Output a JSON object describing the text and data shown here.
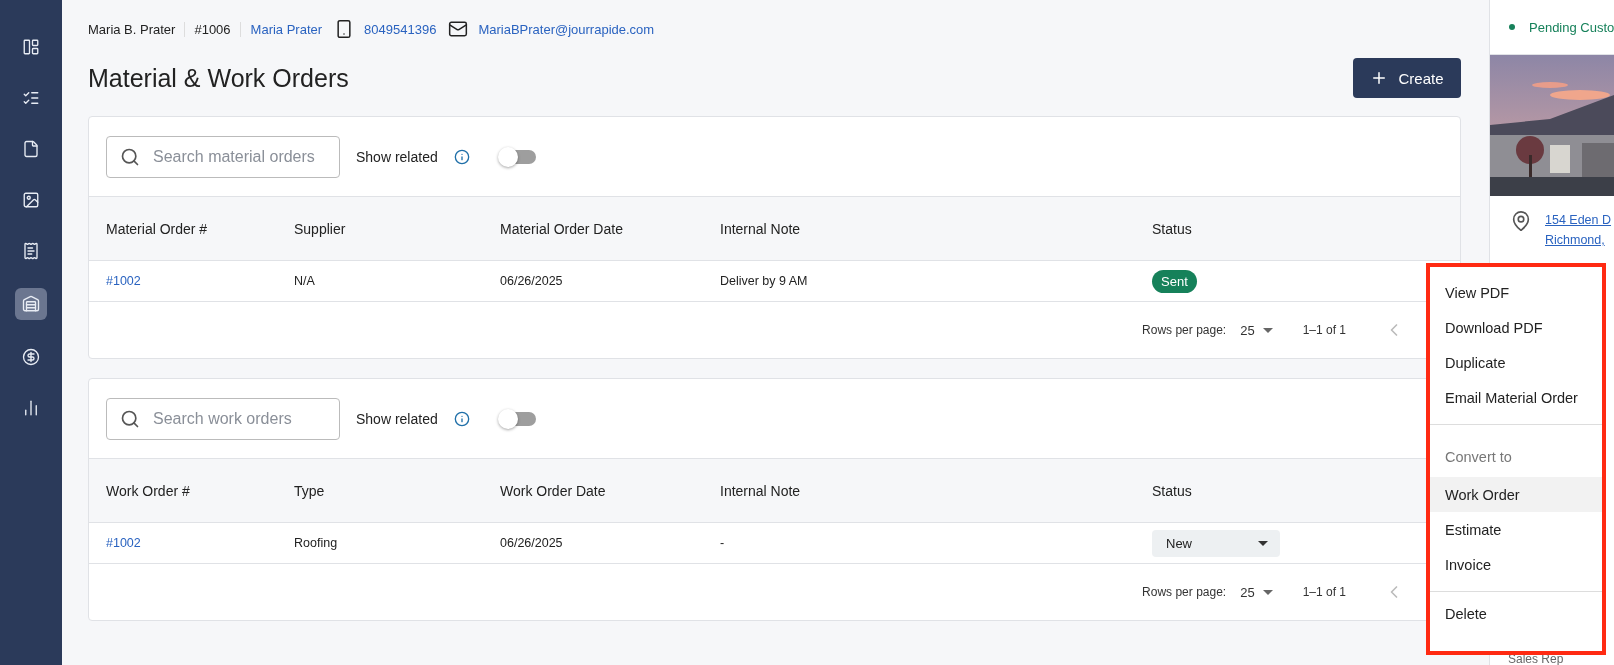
{
  "sidebar": {
    "items": [
      {
        "selected": false
      },
      {
        "selected": false
      },
      {
        "selected": false
      },
      {
        "selected": false
      },
      {
        "selected": false
      },
      {
        "selected": true
      },
      {
        "selected": false
      },
      {
        "selected": false
      }
    ]
  },
  "contact": {
    "name": "Maria B. Prater",
    "number": "#1006",
    "link_name": "Maria Prater",
    "phone": "8049541396",
    "email": "MariaBPrater@jourrapide.com"
  },
  "page_title": "Material & Work Orders",
  "create_button": "Create",
  "tables": [
    {
      "search": {
        "placeholder": "Search material orders"
      },
      "show_related": {
        "label": "Show related",
        "on": false
      },
      "columns": [
        "Material Order #",
        "Supplier",
        "Material Order Date",
        "Internal Note",
        "Status"
      ],
      "rows": [
        {
          "number": "#1002",
          "col2": "N/A",
          "date": "06/26/2025",
          "note": "Deliver by 9 AM",
          "status": {
            "kind": "badge",
            "label": "Sent"
          }
        }
      ],
      "pagination": {
        "label": "Rows per page:",
        "per_page": "25",
        "range": "1–1 of 1"
      }
    },
    {
      "search": {
        "placeholder": "Search work orders"
      },
      "show_related": {
        "label": "Show related",
        "on": false
      },
      "columns": [
        "Work Order #",
        "Type",
        "Work Order Date",
        "Internal Note",
        "Status"
      ],
      "rows": [
        {
          "number": "#1002",
          "col2": "Roofing",
          "date": "06/26/2025",
          "note": "-",
          "status": {
            "kind": "dropdown",
            "label": "New"
          }
        }
      ],
      "pagination": {
        "label": "Rows per page:",
        "per_page": "25",
        "range": "1–1 of 1"
      }
    }
  ],
  "side_panel": {
    "status": "Pending Custo",
    "address_lines": [
      "154 Eden D",
      "Richmond, "
    ],
    "footer_label": "Sales Rep"
  },
  "menu": {
    "sections": [
      {
        "items": [
          {
            "label": "View PDF",
            "selected": false
          },
          {
            "label": "Download PDF",
            "selected": false
          },
          {
            "label": "Duplicate",
            "selected": false
          },
          {
            "label": "Email Material Order",
            "selected": false
          }
        ]
      },
      {
        "header": "Convert to",
        "items": [
          {
            "label": "Work Order",
            "selected": true
          },
          {
            "label": "Estimate",
            "selected": false
          },
          {
            "label": "Invoice",
            "selected": false
          }
        ]
      },
      {
        "items": [
          {
            "label": "Delete",
            "selected": false
          }
        ]
      }
    ]
  }
}
